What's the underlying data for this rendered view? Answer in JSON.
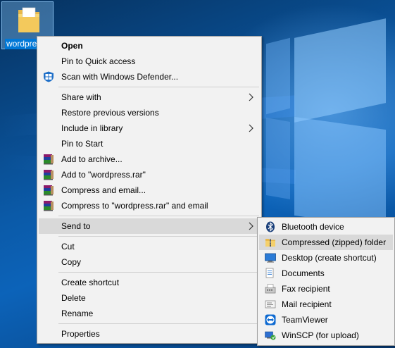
{
  "desktop": {
    "icon_label": "wordpre"
  },
  "context_menu": {
    "items": [
      {
        "label": "Open",
        "bold": true
      },
      {
        "label": "Pin to Quick access"
      },
      {
        "label": "Scan with Windows Defender...",
        "icon": "windows-defender-icon"
      },
      {
        "label": "Share with",
        "submenu": true
      },
      {
        "label": "Restore previous versions"
      },
      {
        "label": "Include in library",
        "submenu": true
      },
      {
        "label": "Pin to Start"
      },
      {
        "label": "Add to archive...",
        "icon": "winrar-icon"
      },
      {
        "label": "Add to \"wordpress.rar\"",
        "icon": "winrar-icon"
      },
      {
        "label": "Compress and email...",
        "icon": "winrar-icon"
      },
      {
        "label": "Compress to \"wordpress.rar\" and email",
        "icon": "winrar-icon"
      },
      {
        "label": "Send to",
        "submenu": true,
        "highlighted": true
      },
      {
        "label": "Cut"
      },
      {
        "label": "Copy"
      },
      {
        "label": "Create shortcut"
      },
      {
        "label": "Delete"
      },
      {
        "label": "Rename"
      },
      {
        "label": "Properties"
      }
    ]
  },
  "send_to_menu": {
    "items": [
      {
        "label": "Bluetooth device",
        "icon": "bluetooth-icon"
      },
      {
        "label": "Compressed (zipped) folder",
        "icon": "zip-folder-icon",
        "highlighted": true
      },
      {
        "label": "Desktop (create shortcut)",
        "icon": "desktop-icon"
      },
      {
        "label": "Documents",
        "icon": "documents-icon"
      },
      {
        "label": "Fax recipient",
        "icon": "fax-icon"
      },
      {
        "label": "Mail recipient",
        "icon": "mail-icon"
      },
      {
        "label": "TeamViewer",
        "icon": "teamviewer-icon"
      },
      {
        "label": "WinSCP (for upload)",
        "icon": "winscp-icon"
      }
    ]
  },
  "colors": {
    "menu_background": "#f2f2f2",
    "highlight": "#d9d9d9",
    "selection_blue": "#0078d7"
  }
}
